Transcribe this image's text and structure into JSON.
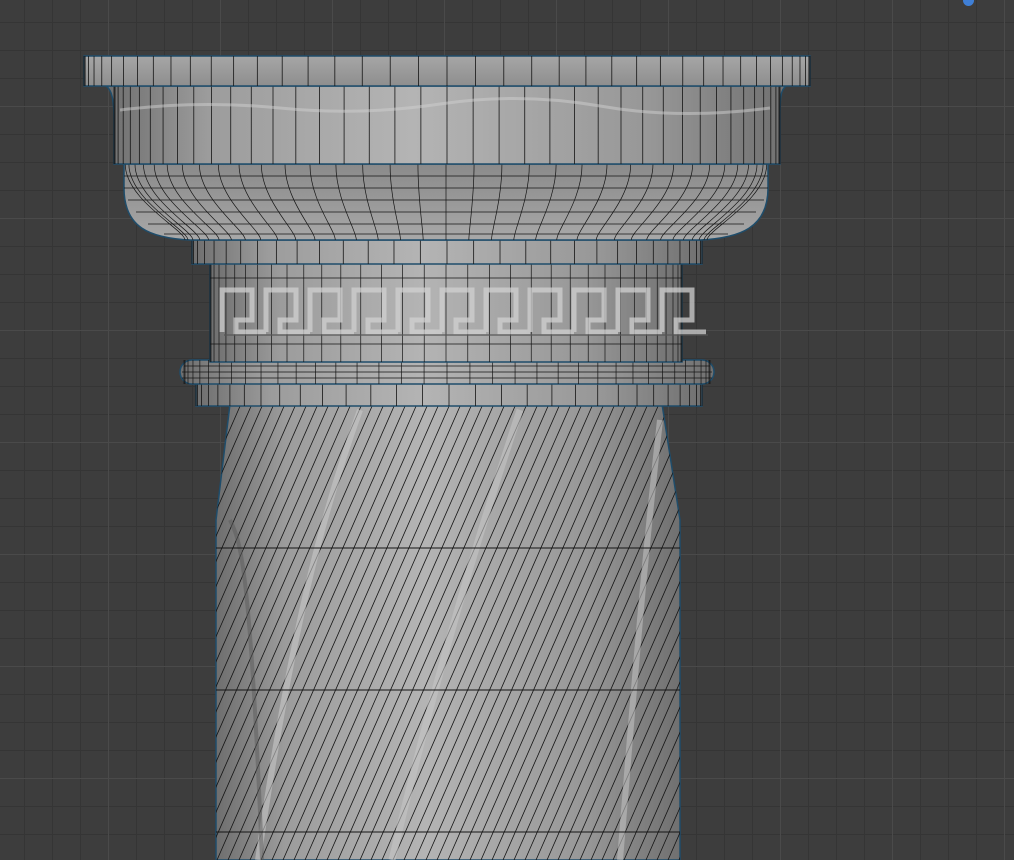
{
  "viewport": {
    "mode": "wireframe-overlay",
    "background": "#3d3d3d",
    "grid_minor": "#353535",
    "grid_major": "#4a4a4a"
  },
  "model": {
    "name": "",
    "parts": [
      "abacus",
      "echinus",
      "necking-ring",
      "greek-key-frieze",
      "astragal",
      "twisted-shaft"
    ],
    "surface_color": "#9a9a9a",
    "wire_color": "#141414",
    "selection_outline": "#1f4d6b"
  },
  "gizmo": {
    "color": "#3f7fd6"
  }
}
